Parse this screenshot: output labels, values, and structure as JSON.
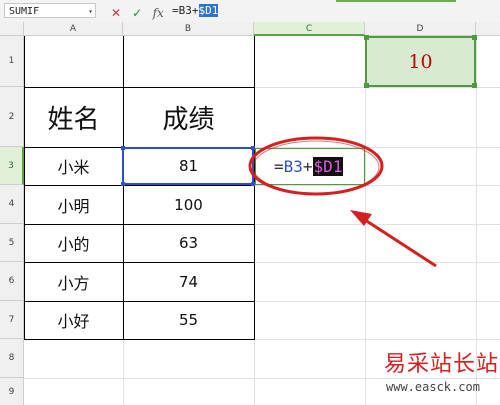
{
  "formula_bar": {
    "name_box": "SUMIF",
    "cancel_icon": "x-icon",
    "enter_icon": "check-icon",
    "fx_label": "fx",
    "formula_prefix": "=B3+",
    "formula_abs": "$D1"
  },
  "columns": [
    "A",
    "B",
    "C",
    "D"
  ],
  "rows": [
    "1",
    "2",
    "3",
    "4",
    "5",
    "6",
    "7",
    "8",
    "9"
  ],
  "table": {
    "headers": [
      "姓名",
      "成绩"
    ],
    "names": [
      "小米",
      "小明",
      "小的",
      "小方",
      "小好"
    ],
    "scores": [
      "81",
      "100",
      "63",
      "74",
      "55"
    ]
  },
  "d1_value": "10",
  "c3_formula": {
    "eq": "=",
    "ref1": "B3",
    "plus": "+",
    "ref2": "$D1"
  },
  "annotation_color": "#d42020",
  "watermark": {
    "cn": "易采站长站",
    "url": "www.easck.com"
  }
}
